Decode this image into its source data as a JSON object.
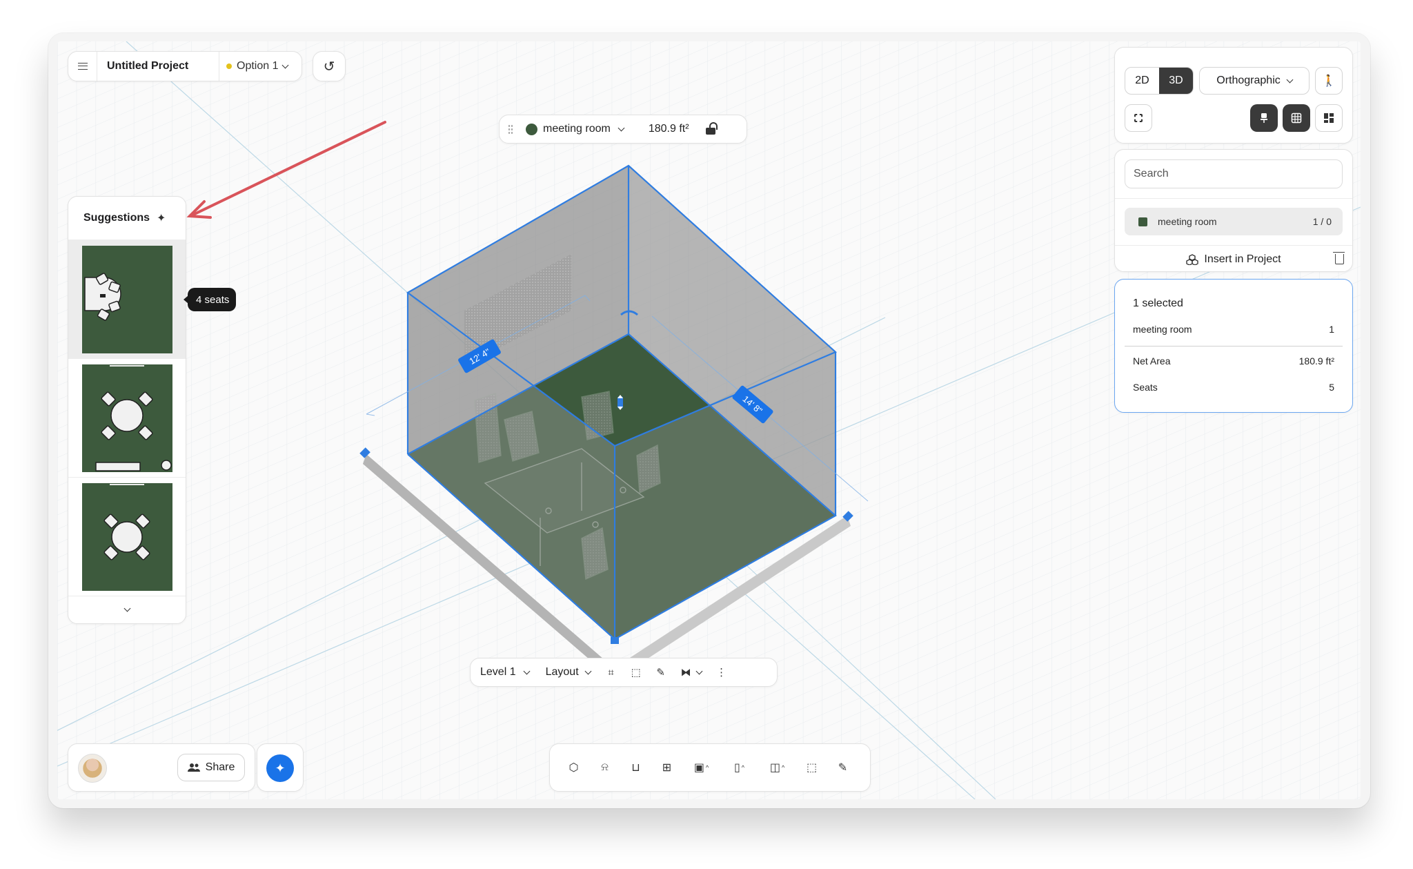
{
  "project": {
    "title": "Untitled Project",
    "option": "Option 1"
  },
  "room_chip": {
    "name": "meeting room",
    "area": "180.9 ft²"
  },
  "suggestions": {
    "title": "Suggestions",
    "tooltip": "4 seats"
  },
  "view": {
    "mode_2d": "2D",
    "mode_3d": "3D",
    "active_mode": "3D",
    "projection": "Orthographic"
  },
  "search": {
    "placeholder": "Search"
  },
  "room_list": [
    {
      "name": "meeting room",
      "count": "1 / 0",
      "color": "#3d5a3d"
    }
  ],
  "insert_label": "Insert in Project",
  "selection": {
    "title": "1 selected",
    "room": {
      "label": "meeting room",
      "value": "1"
    },
    "net_area": {
      "label": "Net Area",
      "value": "180.9 ft²"
    },
    "seats": {
      "label": "Seats",
      "value": "5"
    }
  },
  "dimensions": {
    "left": "12' 4\"",
    "right": "14' 8\""
  },
  "level_bar": {
    "level": "Level 1",
    "layout": "Layout"
  },
  "share_label": "Share",
  "colors": {
    "accent": "#1a73e8",
    "floor": "#3d5a3d",
    "selection_blue": "#2f7de1",
    "arrow": "#d9545a"
  },
  "icons": {
    "tools": [
      "cube-icon",
      "desk-chair-icon",
      "chair-icon",
      "window-grid-icon",
      "image-icon",
      "door-icon",
      "note-icon",
      "select-area-icon",
      "pencil-icon"
    ],
    "level_tools": [
      "frame-icon",
      "dashed-select-icon",
      "tag-icon",
      "mirror-icon",
      "more-icon"
    ]
  }
}
